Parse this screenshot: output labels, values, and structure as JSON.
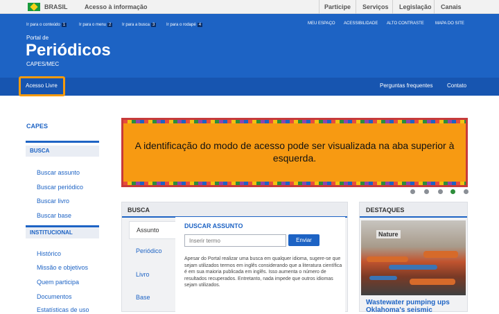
{
  "govbar": {
    "brasil": "BRASIL",
    "acesso": "Acesso à informação",
    "nav": [
      "Participe",
      "Serviços",
      "Legislação",
      "Canais"
    ]
  },
  "header": {
    "skip_links": [
      {
        "label": "Ir para o conteúdo",
        "num": "1"
      },
      {
        "label": "Ir para o menu",
        "num": "2"
      },
      {
        "label": "Ir para a busca",
        "num": "3"
      },
      {
        "label": "Ir para o rodapé",
        "num": "4"
      }
    ],
    "tools": [
      "MEU ESPAÇO",
      "ACESSIBILIDADE",
      "ALTO CONTRASTE",
      "MAPA DO SITE"
    ],
    "portal_label": "Portal de",
    "title": "Periódicos",
    "subtitle": "CAPES/MEC"
  },
  "topnav": {
    "left": "Acesso Livre",
    "right": [
      "Perguntas frequentes",
      "Contato"
    ]
  },
  "sidebar": {
    "heading": "CAPES",
    "busca_heading": "BUSCA",
    "busca_items": [
      "Buscar assunto",
      "Buscar periódico",
      "Buscar livro",
      "Buscar base"
    ],
    "institucional_heading": "INSTITUCIONAL",
    "institucional_items": [
      "Histórico",
      "Missão e objetivos",
      "Quem participa",
      "Documentos",
      "Estatísticas de uso"
    ]
  },
  "banner": {
    "text": "A identificação do modo de acesso pode ser visualizada na aba superior à esquerda."
  },
  "busca": {
    "heading": "BUSCA",
    "tabs": [
      "Assunto",
      "Periódico",
      "Livro",
      "Base"
    ],
    "panel_heading": "DUSCAR ASSUNTO",
    "input_placeholder": "Inserir termo",
    "send_label": "Enviar",
    "description": "Apesar do Portal realizar uma busca em qualquer idioma, sugere-se que sejam utilizados termos em inglês considerando que a literatura científica é em sua maioria publicada em inglês. Isso aumenta o número de resultados recuperados. Entretanto, nada impede que outros idiomas sejam utilizados."
  },
  "destaques": {
    "heading": "DESTAQUES",
    "photo_label": "Nature",
    "caption": "Wastewater pumping ups Oklahoma's seismic"
  },
  "colors": {
    "header_blue": "#1d63c4",
    "nav_blue": "#1755b0",
    "highlight_orange": "#f59a0c",
    "banner_orange": "#f79a12",
    "active_dot_green": "#2d8d3b"
  }
}
